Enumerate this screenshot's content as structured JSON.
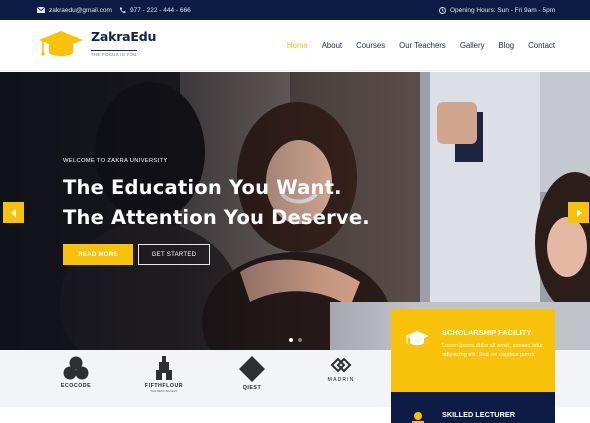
{
  "topbar": {
    "email": "zakraedu@gmail.com",
    "phone": "977 - 222 - 444 - 666",
    "hours": "Opening Hours:  Sun - Fri  9am - 5pm"
  },
  "logo": {
    "name": "ZakraEdu",
    "tagline": "THE FOCUS IS YOU"
  },
  "nav": [
    "Home",
    "About",
    "Courses",
    "Our Teachers",
    "Gallery",
    "Blog",
    "Contact"
  ],
  "hero": {
    "welcome": "WELCOME TO ZAKRA UNIVERSITY",
    "line1": "The Education You Want.",
    "line2": "The Attention You Deserve.",
    "read_more": "READ MORE",
    "get_started": "GET STARTED",
    "slides_total": 2,
    "active_slide": 1
  },
  "partners": [
    {
      "name": "ECOCODE",
      "sub": ""
    },
    {
      "name": "FIFTHFLOUR",
      "sub": "THE BEST BAKERY"
    },
    {
      "name": "QIEST",
      "sub": ""
    },
    {
      "name": "MADRIN",
      "sub": ""
    }
  ],
  "features": [
    {
      "title": "SCHOLARSHIP FACILITY",
      "text": "Lorem ipsum dolor sit amet, consec tetur adipiscing elit. Sed vel dapibus purus."
    },
    {
      "title": "SKILLED LECTURER",
      "text": ""
    }
  ],
  "colors": {
    "accent": "#f8c20a",
    "navy": "#0d1c44",
    "active_nav": "#f4bb12"
  }
}
